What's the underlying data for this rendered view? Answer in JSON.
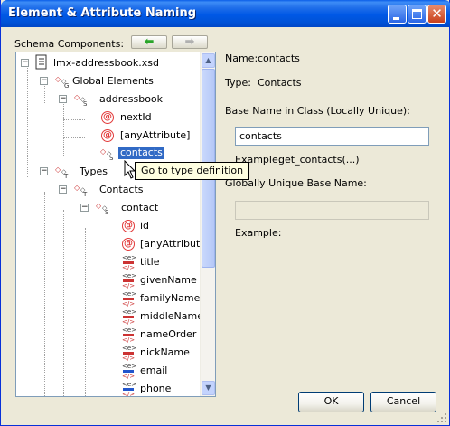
{
  "window": {
    "title": "Element & Attribute Naming"
  },
  "left": {
    "schema_label": "Schema Components:",
    "nav_back_icon": "arrow-left-icon",
    "nav_forward_icon": "arrow-right-icon"
  },
  "tree": {
    "root": "lmx-addressbook.xsd",
    "global_elements": "Global Elements",
    "addressbook": "addressbook",
    "nextId": "nextId",
    "anyAttribute": "[anyAttribute]",
    "contacts_sel": "contacts",
    "types": "Types",
    "Contacts": "Contacts",
    "contact": "contact",
    "id": "id",
    "anyAttribute2": "[anyAttribute",
    "title": "title",
    "givenName": "givenName",
    "familyName": "familyName",
    "middleNames": "middleNames",
    "nameOrder": "nameOrder",
    "nickName": "nickName",
    "email": "email",
    "phone": "phone"
  },
  "tooltip": "Go to type definition",
  "right": {
    "name_label": "Name:",
    "name_value": "contacts",
    "type_label": "Type:",
    "type_value": "Contacts",
    "base_name_label": "Base Name in Class (Locally Unique):",
    "base_name_value": "contacts",
    "example1_label": "Example:",
    "example1_value": "get_contacts(...)",
    "global_label": "Globally Unique Base Name:",
    "global_value": "",
    "example2_label": "Example:"
  },
  "buttons": {
    "ok": "OK",
    "cancel": "Cancel"
  }
}
